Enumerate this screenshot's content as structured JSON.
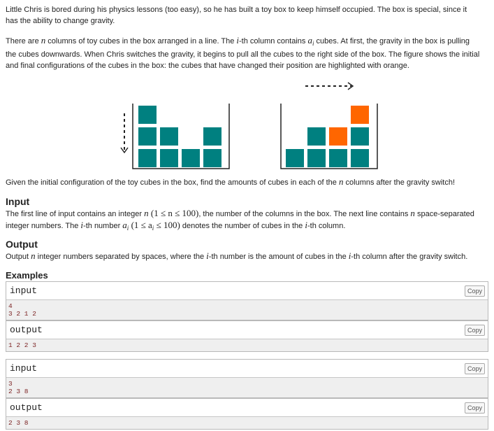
{
  "statement": {
    "intro_a": "Little Chris is bored during his physics lessons (too easy), so he has built a toy box to keep himself occupied. The box is special, since it",
    "intro_b": "has the ability to change gravity.",
    "p2_l1_a": "There are ",
    "p2_l1_n": "n",
    "p2_l1_b": " columns of toy cubes in the box arranged in a line. The ",
    "p2_l1_i": "i",
    "p2_l1_c": "-th column contains ",
    "p2_l1_ai": "a",
    "p2_l1_ai_sub": "i",
    "p2_l1_d": " cubes. At first, the gravity in the box is pulling",
    "p2_l2": "the cubes downwards. When Chris switches the gravity, it begins to pull all the cubes to the right side of the box. The figure shows the initial",
    "p2_l3": "and final configurations of the cubes in the box: the cubes that have changed their position are highlighted with orange.",
    "task_a": "Given the initial configuration of the toy cubes in the box, find the amounts of cubes in each of the ",
    "task_n": "n",
    "task_b": " columns after the gravity switch!"
  },
  "figure": {
    "cube_color": "#008080",
    "moved_color": "#ff6600",
    "before": [
      3,
      2,
      1,
      2
    ],
    "after": [
      1,
      2,
      2,
      3
    ]
  },
  "input_section": {
    "title": "Input",
    "l1_a": "The first line of input contains an integer ",
    "l1_n": "n",
    "l1_range": " (1 ≤ n ≤ 100)",
    "l1_b": ", the number of the columns in the box. The next line contains ",
    "l1_n2": "n",
    "l1_c": " space-separated",
    "l2_a": "integer numbers. The ",
    "l2_i": "i",
    "l2_b": "-th number ",
    "l2_ai": "a",
    "l2_ai_sub": "i",
    "l2_range": " (1 ≤ a",
    "l2_range_sub": "i",
    "l2_range_end": " ≤ 100)",
    "l2_c": " denotes the number of cubes in the ",
    "l2_i2": "i",
    "l2_d": "-th column."
  },
  "output_section": {
    "title": "Output",
    "l1_a": "Output ",
    "l1_n": "n",
    "l1_b": " integer numbers separated by spaces, where the ",
    "l1_i": "i",
    "l1_c": "-th number is the amount of cubes in the ",
    "l1_i2": "i",
    "l1_d": "-th column after the gravity switch."
  },
  "examples": {
    "title": "Examples",
    "copy_label": "Copy",
    "input_label": "input",
    "output_label": "output",
    "tests": [
      {
        "input": [
          "4",
          "3 2 1 2"
        ],
        "output": [
          "1 2 2 3"
        ]
      },
      {
        "input": [
          "3",
          "2 3 8"
        ],
        "output": [
          "2 3 8"
        ]
      }
    ]
  }
}
